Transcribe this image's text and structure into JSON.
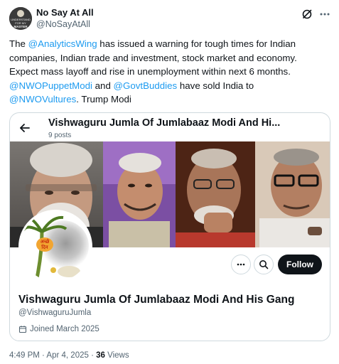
{
  "author": {
    "name": "No Say At All",
    "handle": "@NoSayAtAll",
    "avatar_text": [
      "UNDERSTAND",
      "FOR MY",
      "MASTER"
    ]
  },
  "tweet": {
    "line1": {
      "prefix": "The ",
      "mention": "@AnalyticsWing",
      "suffix": " has issued a warning for tough times for Indian"
    },
    "line2": "companies, Indian trade and investment, stock market and economy.",
    "line3": "Expect mass layoff and rise in unemployment within next 6 months.",
    "line4": {
      "mention1": "@NWOPuppetModi",
      "and": " and ",
      "mention2": "@GovtBuddies",
      "suffix": " have sold India to"
    },
    "line5": {
      "mention": "@NWOVultures",
      "suffix": ". Trump Modi"
    }
  },
  "card": {
    "title": "Vishwaguru Jumla Of Jumlabaaz Modi And Hi...",
    "posts": "9 posts",
    "profile_pic_text": [
      "अच्छे",
      "दिन"
    ],
    "follow_label": "Follow",
    "profile_name": "Vishwaguru Jumla Of Jumlabaaz Modi And His Gang",
    "profile_handle": "@VishwaguruJumla",
    "joined": "Joined March 2025"
  },
  "meta": {
    "time": "4:49 PM",
    "sep1": " · ",
    "date": "Apr 4, 2025",
    "sep2": " · ",
    "views_count": "36",
    "views_label": " Views"
  },
  "colors": {
    "link": "#1d9bf0",
    "text": "#0f1419",
    "muted": "#536471",
    "border": "#cfd9de",
    "follow_bg": "#0f1419"
  }
}
